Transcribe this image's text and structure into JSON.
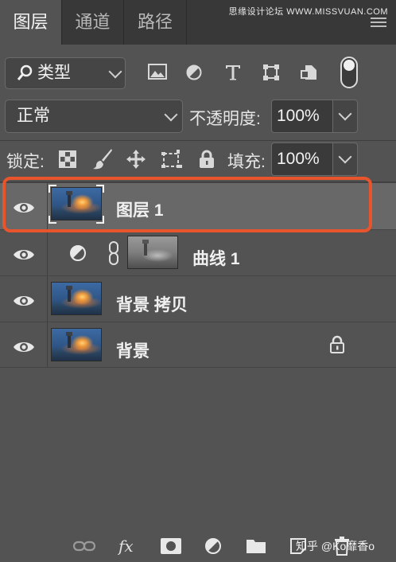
{
  "tabs": [
    {
      "label": "图层",
      "active": true
    },
    {
      "label": "通道",
      "active": false
    },
    {
      "label": "路径",
      "active": false
    }
  ],
  "watermark": "思缘设计论坛 WWW.MISSVUAN.COM",
  "filter": {
    "label": "类型",
    "icons": [
      "image-filter-icon",
      "adjustment-filter-icon",
      "type-filter-icon",
      "shape-filter-icon",
      "smart-object-filter-icon"
    ]
  },
  "blend": {
    "mode": "正常",
    "opacity_label": "不透明度:",
    "opacity_value": "100%"
  },
  "lock": {
    "label": "锁定:",
    "fill_label": "填充:",
    "fill_value": "100%"
  },
  "layers": [
    {
      "name": "图层 1",
      "selected": true,
      "type": "pixel"
    },
    {
      "name": "曲线 1",
      "selected": false,
      "type": "curves-adjustment"
    },
    {
      "name": "背景 拷贝",
      "selected": false,
      "type": "pixel"
    },
    {
      "name": "背景",
      "selected": false,
      "type": "background",
      "locked": true
    }
  ],
  "bottom": {
    "overlay_text": "知乎 @Ko靡香o"
  },
  "colors": {
    "panel": "#535353",
    "tabbar": "#383838",
    "selection_outline": "#e8542b",
    "selected_row": "#686868"
  }
}
